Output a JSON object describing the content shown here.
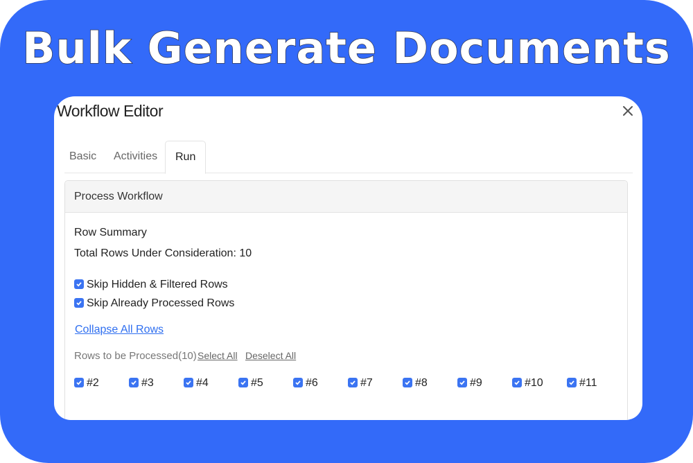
{
  "banner": {
    "title": "Bulk Generate Documents",
    "background": "#336af9"
  },
  "dialog": {
    "title": "Workflow Editor",
    "close_icon": "close-icon",
    "tabs": [
      {
        "label": "Basic",
        "active": false
      },
      {
        "label": "Activities",
        "active": false
      },
      {
        "label": "Run",
        "active": true
      }
    ],
    "panel": {
      "title": "Process Workflow",
      "row_summary_heading": "Row Summary",
      "total_rows_text": "Total Rows Under Consideration: 10",
      "options": [
        {
          "label": "Skip Hidden & Filtered Rows",
          "checked": true
        },
        {
          "label": "Skip Already Processed Rows",
          "checked": true
        }
      ],
      "collapse_link": "Collapse All Rows",
      "rows_label": "Rows to be Processed(10)",
      "select_all": "Select All",
      "deselect_all": "Deselect All",
      "rows": [
        {
          "label": "#2",
          "checked": true
        },
        {
          "label": "#3",
          "checked": true
        },
        {
          "label": "#4",
          "checked": true
        },
        {
          "label": "#5",
          "checked": true
        },
        {
          "label": "#6",
          "checked": true
        },
        {
          "label": "#7",
          "checked": true
        },
        {
          "label": "#8",
          "checked": true
        },
        {
          "label": "#9",
          "checked": true
        },
        {
          "label": "#10",
          "checked": true
        },
        {
          "label": "#11",
          "checked": true
        }
      ]
    }
  },
  "colors": {
    "accent": "#3b74f2",
    "link": "#2f6ff0"
  }
}
